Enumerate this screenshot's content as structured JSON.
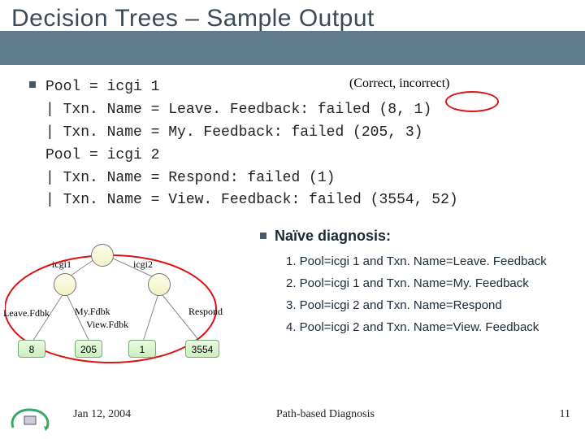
{
  "title": "Decision Trees – Sample Output",
  "annotation_correct": "(Correct, incorrect)",
  "code_lines": {
    "l1": "Pool = icgi 1",
    "l2": "| Txn. Name = Leave. Feedback: failed (8, 1)",
    "l3": "| Txn. Name = My. Feedback: failed (205, 3)",
    "l4": "Pool = icgi 2",
    "l5": "| Txn. Name = Respond: failed (1)",
    "l6": "| Txn. Name = View. Feedback: failed (3554, 52)"
  },
  "naive_heading": "Naïve diagnosis:",
  "diagnosis": {
    "d1": "1. Pool=icgi 1 and Txn. Name=Leave. Feedback",
    "d2": "2. Pool=icgi 1 and Txn. Name=My. Feedback",
    "d3": "3. Pool=icgi 2 and Txn. Name=Respond",
    "d4": "4. Pool=icgi 2 and Txn. Name=View. Feedback"
  },
  "tree": {
    "top_left": "icgi1",
    "top_right": "icgi2",
    "edge_leave": "Leave.Fdbk",
    "edge_my": "My.Fdbk",
    "edge_view": "View.Fdbk",
    "edge_respond": "Respond",
    "leaf_8": "8",
    "leaf_205": "205",
    "leaf_1": "1",
    "leaf_3554": "3554"
  },
  "footer": {
    "date": "Jan 12, 2004",
    "mid": "Path-based Diagnosis",
    "page": "11"
  }
}
